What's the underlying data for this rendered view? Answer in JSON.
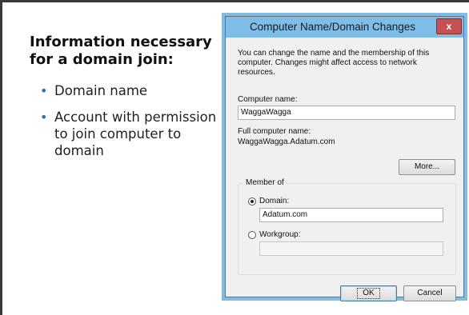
{
  "slide": {
    "heading": "Information necessary for a domain join:",
    "bullets": [
      "Domain name",
      "Account with permission to join computer to domain"
    ]
  },
  "dialog": {
    "title": "Computer Name/Domain Changes",
    "close_label": "x",
    "description": "You can change the name and the membership of this computer. Changes might affect access to network resources.",
    "computer_name_label": "Computer name:",
    "computer_name_value": "WaggaWagga",
    "full_name_label": "Full computer name:",
    "full_name_value": "WaggaWagga.Adatum.com",
    "more_button": "More...",
    "member_of_label": "Member of",
    "domain_label": "Domain:",
    "domain_value": "Adatum.com",
    "workgroup_label": "Workgroup:",
    "workgroup_value": "",
    "ok_button": "OK",
    "cancel_button": "Cancel",
    "selected_membership": "domain"
  },
  "colors": {
    "titlebar": "#7fbde9",
    "close_button": "#c75050",
    "bullet": "#2c6fb7"
  }
}
